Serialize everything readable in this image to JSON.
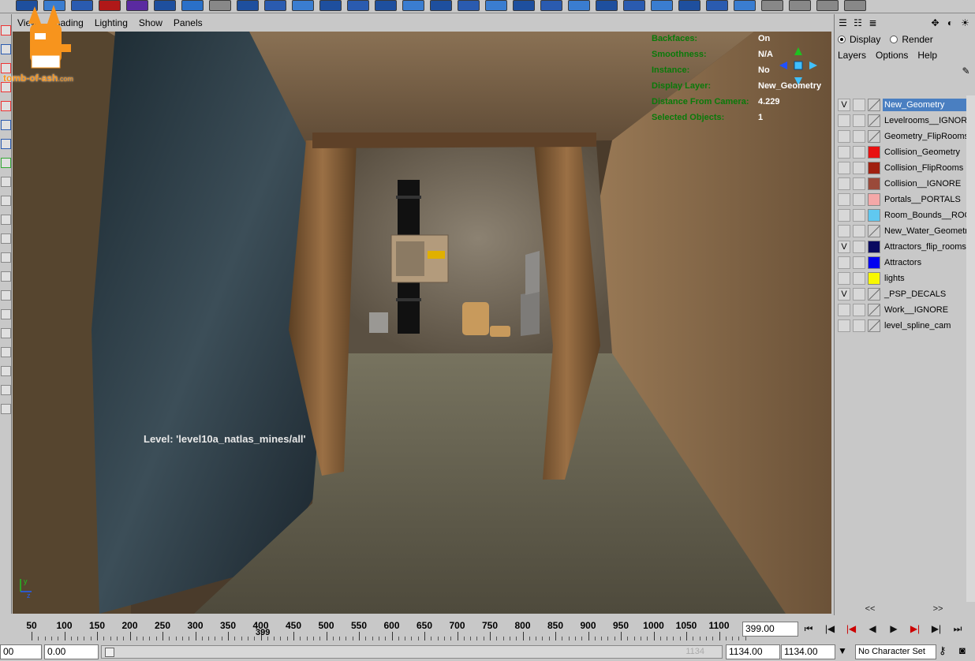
{
  "panel_menu": [
    "View",
    "Shading",
    "Lighting",
    "Show",
    "Panels"
  ],
  "watermark": {
    "text": "tomb-of-ash",
    "suffix": ".com"
  },
  "hud": [
    {
      "label": "Backfaces:",
      "value": "On"
    },
    {
      "label": "Smoothness:",
      "value": "N/A"
    },
    {
      "label": "Instance:",
      "value": "No"
    },
    {
      "label": "Display Layer:",
      "value": "New_Geometry"
    },
    {
      "label": "Distance From Camera:",
      "value": "4.229"
    },
    {
      "label": "Selected Objects:",
      "value": "1"
    }
  ],
  "level_label": "Level: 'level10a_natlas_mines/all'",
  "layer_editor": {
    "display_label": "Display",
    "render_label": "Render",
    "menu": [
      "Layers",
      "Options",
      "Help"
    ],
    "layers": [
      {
        "name": "New_Geometry",
        "visible": "V",
        "color": null,
        "selected": true
      },
      {
        "name": "Levelrooms__IGNORE",
        "visible": "",
        "color": null
      },
      {
        "name": "Geometry_FlipRooms",
        "visible": "",
        "color": null
      },
      {
        "name": "Collision_Geometry",
        "visible": "",
        "color": "#e81010"
      },
      {
        "name": "Collision_FlipRooms",
        "visible": "",
        "color": "#a02010"
      },
      {
        "name": "Collision__IGNORE",
        "visible": "",
        "color": "#9a4a3a"
      },
      {
        "name": "Portals__PORTALS",
        "visible": "",
        "color": "#f4a8a8"
      },
      {
        "name": "Room_Bounds__ROOMS",
        "visible": "",
        "color": "#60c8f0"
      },
      {
        "name": "New_Water_Geometry",
        "visible": "",
        "color": null
      },
      {
        "name": "Attractors_flip_rooms",
        "visible": "V",
        "color": "#0a0a60"
      },
      {
        "name": "Attractors",
        "visible": "",
        "color": "#0000f0"
      },
      {
        "name": "lights",
        "visible": "",
        "color": "#f8f800"
      },
      {
        "name": "_PSP_DECALS",
        "visible": "V",
        "color": null
      },
      {
        "name": "Work__IGNORE",
        "visible": "",
        "color": null
      },
      {
        "name": "level_spline_cam",
        "visible": "",
        "color": null
      }
    ],
    "scroll_left": "<<",
    "scroll_right": ">>"
  },
  "time_slider": {
    "ticks": [
      "50",
      "100",
      "150",
      "200",
      "250",
      "300",
      "350",
      "400",
      "450",
      "500",
      "550",
      "600",
      "650",
      "700",
      "750",
      "800",
      "850",
      "900",
      "950",
      "1000",
      "1050",
      "1100"
    ],
    "current_frame_marker": "399",
    "current_frame": "399.00"
  },
  "range_slider": {
    "start_time": "00",
    "playback_start": "0.00",
    "range_end_label": "1134",
    "playback_end": "1134.00",
    "end_time": "1134.00",
    "character_set": "No Character Set"
  },
  "colors": {
    "hud_label": "#0a7a0a",
    "selection": "#4a7fc1",
    "ui_gray": "#c8c8c8"
  }
}
